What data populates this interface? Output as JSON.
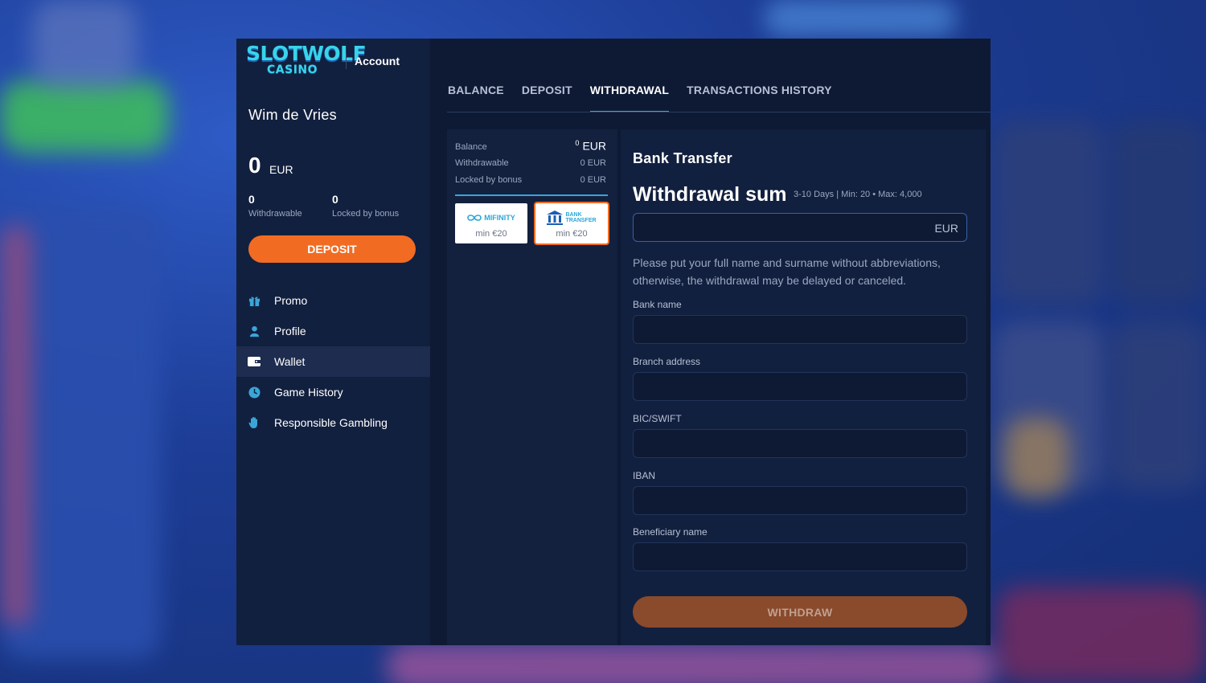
{
  "header": {
    "logo_top": "SLOTWOLF",
    "logo_bottom": "CASINO",
    "title": "Account"
  },
  "user": {
    "name": "Wim de Vries",
    "balance": "0",
    "currency": "EUR",
    "withdrawable_value": "0",
    "withdrawable_label": "Withdrawable",
    "locked_value": "0",
    "locked_label": "Locked by bonus"
  },
  "sidebar": {
    "deposit_label": "DEPOSIT",
    "items": [
      {
        "label": "Promo",
        "icon": "gift-icon"
      },
      {
        "label": "Profile",
        "icon": "user-icon"
      },
      {
        "label": "Wallet",
        "icon": "wallet-icon",
        "active": true
      },
      {
        "label": "Game History",
        "icon": "clock-icon"
      },
      {
        "label": "Responsible Gambling",
        "icon": "hand-icon"
      }
    ]
  },
  "tabs": [
    {
      "label": "BALANCE"
    },
    {
      "label": "DEPOSIT"
    },
    {
      "label": "WITHDRAWAL",
      "active": true
    },
    {
      "label": "TRANSACTIONS HISTORY"
    }
  ],
  "balance_panel": {
    "balance_label": "Balance",
    "balance_sup": "0",
    "balance_value": "EUR",
    "withdrawable_label": "Withdrawable",
    "withdrawable_value": "0 EUR",
    "locked_label": "Locked by bonus",
    "locked_value": "0 EUR"
  },
  "payment_methods": [
    {
      "name": "MIFINITY",
      "min": "min €20",
      "selected": false
    },
    {
      "name_line1": "BANK",
      "name_line2": "TRANSFER",
      "min": "min €20",
      "selected": true
    }
  ],
  "form": {
    "title": "Bank Transfer",
    "sum_title": "Withdrawal sum",
    "sum_note": "3-10 Days | Min: 20 • Max: 4,000",
    "sum_currency": "EUR",
    "note": "Please put your full name and surname without abbreviations, otherwise, the withdrawal may be delayed or canceled.",
    "fields": [
      {
        "label": "Bank name",
        "value": ""
      },
      {
        "label": "Branch address",
        "value": ""
      },
      {
        "label": "BIC/SWIFT",
        "value": ""
      },
      {
        "label": "IBAN",
        "value": ""
      },
      {
        "label": "Beneficiary name",
        "value": ""
      }
    ],
    "submit_label": "WITHDRAW"
  },
  "colors": {
    "accent_orange": "#f26b22",
    "accent_blue": "#3aa6d8",
    "panel_bg": "#12203f",
    "modal_bg": "#0e1a34"
  }
}
